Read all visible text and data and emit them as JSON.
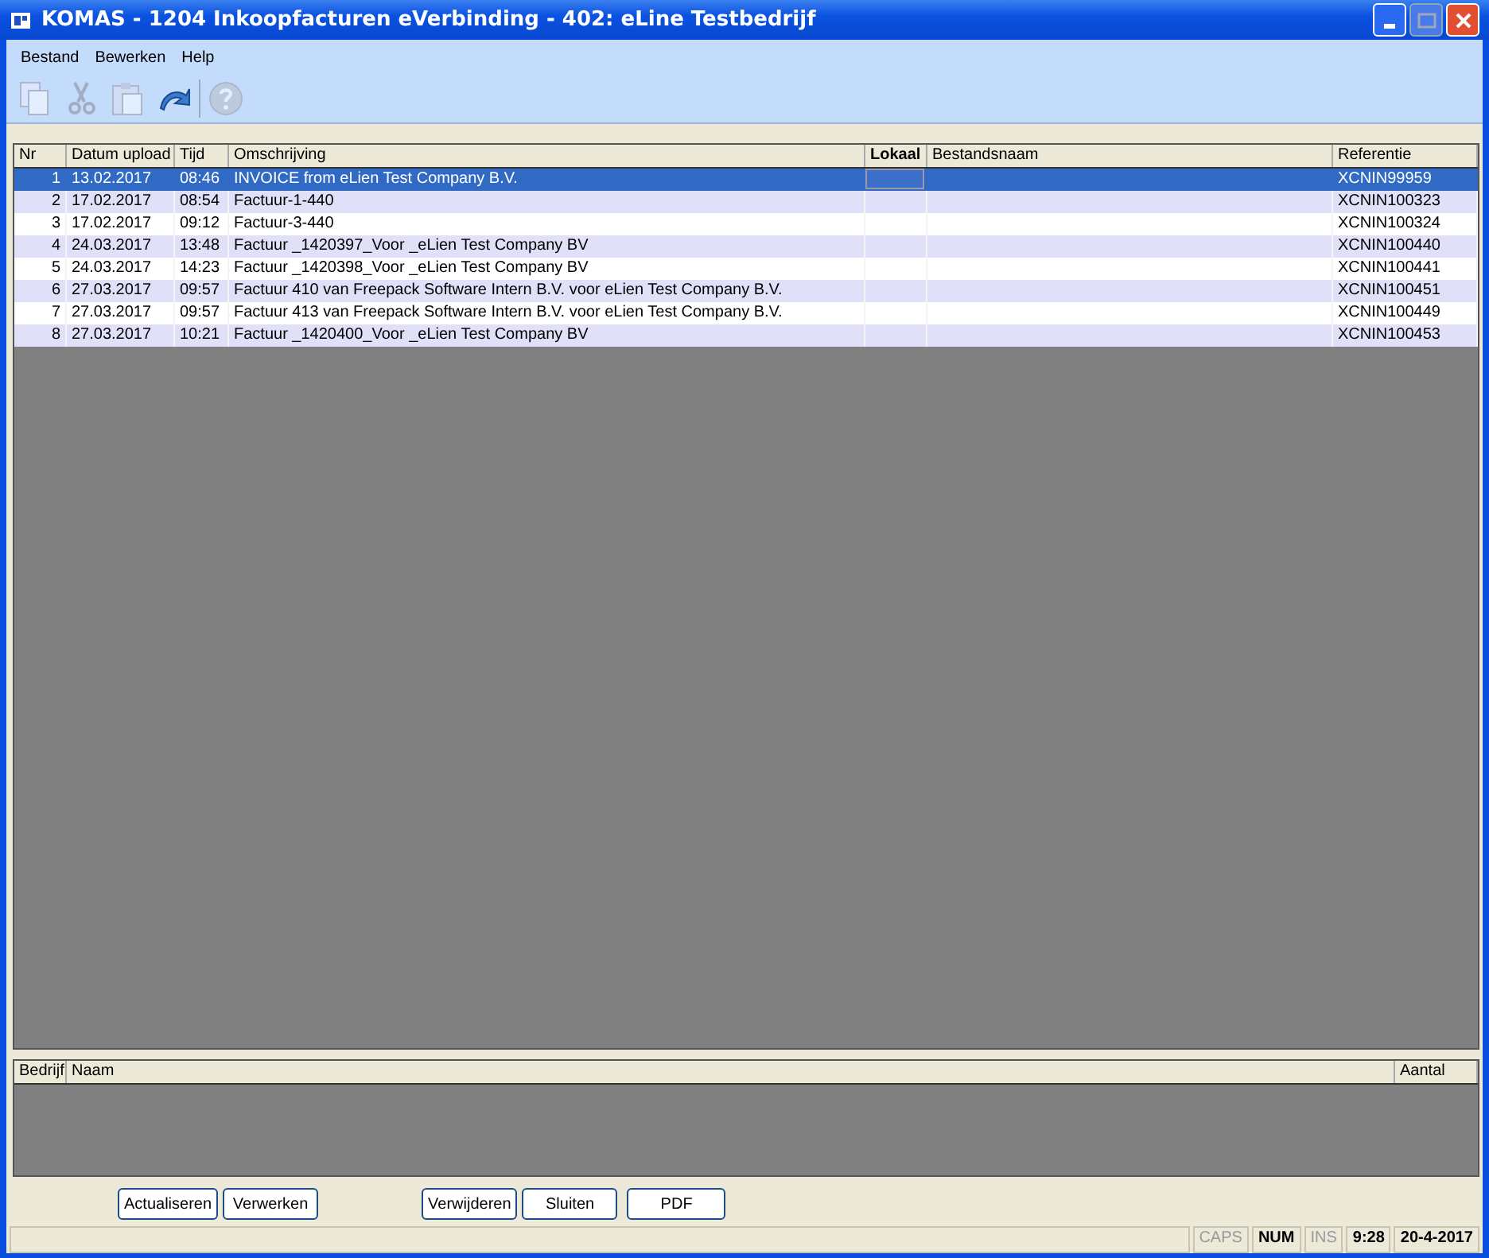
{
  "window": {
    "title": "KOMAS - 1204 Inkoopfacturen eVerbinding - 402: eLine Testbedrijf"
  },
  "menu": [
    "Bestand",
    "Bewerken",
    "Help"
  ],
  "toolbar": [
    {
      "kind": "copy",
      "disabled": true
    },
    {
      "kind": "cut",
      "disabled": true
    },
    {
      "kind": "paste",
      "disabled": true
    },
    {
      "kind": "undo",
      "disabled": false
    },
    {
      "kind": "help",
      "disabled": true
    }
  ],
  "table": {
    "columns": [
      "Nr",
      "Datum upload",
      "Tijd",
      "Omschrijving",
      "Lokaal",
      "Bestandsnaam",
      "Referentie"
    ],
    "rows": [
      {
        "nr": "1",
        "date": "13.02.2017",
        "time": "08:46",
        "description": "INVOICE from eLien Test Company B.V.",
        "reference": "XCNIN99959",
        "selected": true
      },
      {
        "nr": "2",
        "date": "17.02.2017",
        "time": "08:54",
        "description": "Factuur-1-440",
        "reference": "XCNIN100323",
        "selected": false
      },
      {
        "nr": "3",
        "date": "17.02.2017",
        "time": "09:12",
        "description": "Factuur-3-440",
        "reference": "XCNIN100324",
        "selected": false
      },
      {
        "nr": "4",
        "date": "24.03.2017",
        "time": "13:48",
        "description": "Factuur _1420397_Voor _eLien Test Company BV",
        "reference": "XCNIN100440",
        "selected": false
      },
      {
        "nr": "5",
        "date": "24.03.2017",
        "time": "14:23",
        "description": "Factuur _1420398_Voor _eLien Test Company BV",
        "reference": "XCNIN100441",
        "selected": false
      },
      {
        "nr": "6",
        "date": "27.03.2017",
        "time": "09:57",
        "description": "Factuur 410 van Freepack Software Intern B.V. voor eLien Test Company B.V.",
        "reference": "XCNIN100451",
        "selected": false
      },
      {
        "nr": "7",
        "date": "27.03.2017",
        "time": "09:57",
        "description": "Factuur 413 van Freepack Software Intern B.V. voor eLien Test Company B.V.",
        "reference": "XCNIN100449",
        "selected": false
      },
      {
        "nr": "8",
        "date": "27.03.2017",
        "time": "10:21",
        "description": "Factuur _1420400_Voor _eLien Test Company BV",
        "reference": "XCNIN100453",
        "selected": false
      }
    ]
  },
  "summary_table": {
    "columns": [
      "Bedrijf",
      "Naam",
      "Aantal"
    ]
  },
  "buttons": [
    "Actualiseren",
    "Verwerken",
    "Verwijderen",
    "Sluiten",
    "PDF"
  ],
  "status_bar": [
    {
      "text": "CAPS",
      "on": false
    },
    {
      "text": "NUM",
      "on": true
    },
    {
      "text": "INS",
      "on": false
    },
    {
      "text": "9:28",
      "on": true
    },
    {
      "text": "20-4-2017",
      "on": true
    }
  ]
}
